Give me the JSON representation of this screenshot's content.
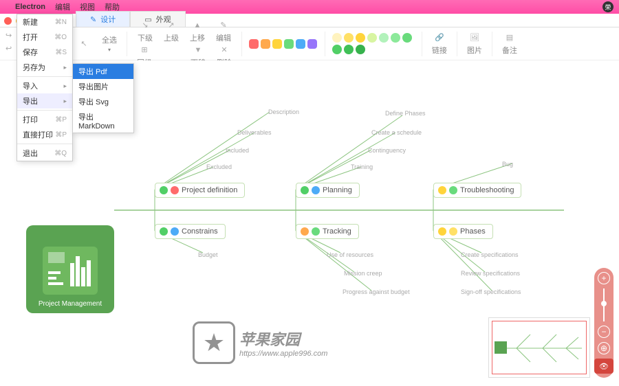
{
  "menubar": {
    "app": "Electron",
    "items": [
      "编辑",
      "视图",
      "帮助"
    ]
  },
  "tabs": {
    "design": "设计",
    "appearance": "外观"
  },
  "toolbar": {
    "select": "全选",
    "down": "下级",
    "up": "上级",
    "moveup": "上移",
    "edit": "编辑",
    "same": "同级",
    "movedown": "下移",
    "delete": "删除",
    "link": "链接",
    "image": "图片",
    "note": "备注"
  },
  "menu": {
    "new": "新建",
    "open": "打开",
    "save": "保存",
    "saveas": "另存为",
    "import": "导入",
    "export": "导出",
    "print": "打印",
    "printd": "直接打印",
    "exit": "退出",
    "sc": {
      "new": "⌘N",
      "open": "⌘O",
      "save": "⌘S",
      "print": "⌘P",
      "printd": "⌘P",
      "exit": "⌘Q"
    }
  },
  "submenu": {
    "pdf": "导出 Pdf",
    "img": "导出图片",
    "svg": "导出 Svg",
    "md": "导出 MarkDown"
  },
  "diagram": {
    "root": "Project Management",
    "n1": "Project definition",
    "n2": "Planning",
    "n3": "Troubleshooting",
    "n4": "Constrains",
    "n5": "Tracking",
    "n6": "Phases",
    "b": {
      "desc": "Description",
      "deliv": "Deliverables",
      "incl": "Included",
      "excl": "Excluded",
      "defphases": "Define Phases",
      "sched": "Create a schedule",
      "cont": "Continguency",
      "train": "Training",
      "bug": "Bug",
      "budget": "Budget",
      "useres": "Use of resources",
      "creep": "Mission creep",
      "pab": "Progress against budget",
      "cspec": "Create specifications",
      "rspec": "Review specifications",
      "sspec": "Sign-off specifications"
    }
  },
  "watermark": {
    "t1": "苹果家园",
    "t2": "https://www.apple996.com"
  },
  "colors": {
    "boxes": [
      "#ff6b6b",
      "#ffa94d",
      "#ffd43b",
      "#69db7c",
      "#4dabf7",
      "#9775fa"
    ],
    "dots": [
      "#fff3bf",
      "#ffe066",
      "#ffd43b",
      "#d8f5a2",
      "#b2f2bb",
      "#8ce99a",
      "#69db7c",
      "#51cf66",
      "#40c057",
      "#37b24d"
    ]
  }
}
